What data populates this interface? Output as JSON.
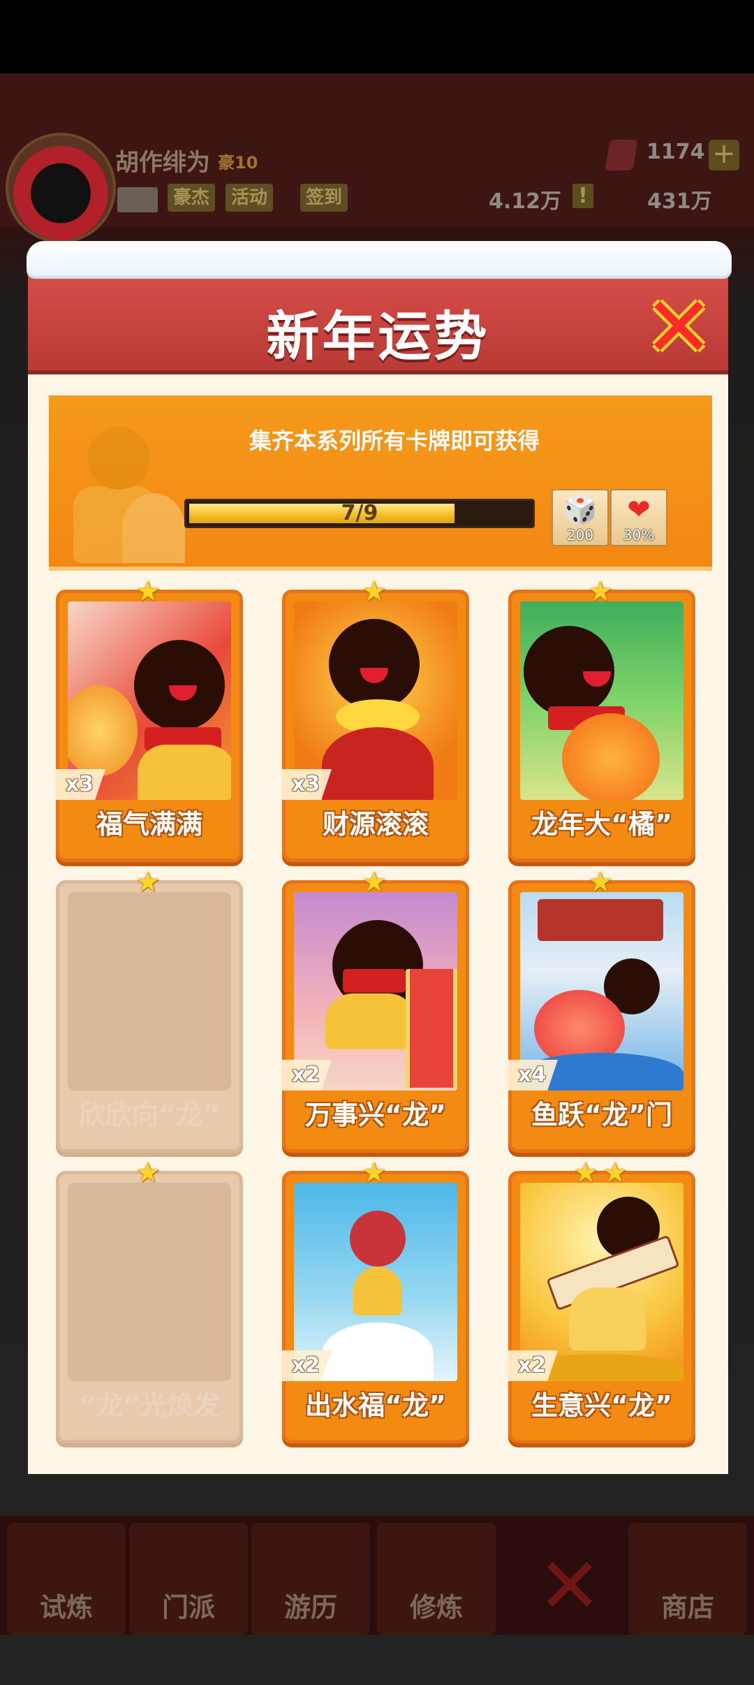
{
  "player": {
    "name": "胡作绯为",
    "level": "豪10",
    "buttons": [
      "豪杰",
      "活动",
      "签到"
    ],
    "gems": "1174",
    "power": "4.12万",
    "coins": "431万",
    "power_alert": "!",
    "add": "+"
  },
  "nav": {
    "items": [
      "试炼",
      "门派",
      "游历",
      "修炼",
      "商店"
    ],
    "close_icon": "✕"
  },
  "modal": {
    "title": "新年运势",
    "close_icon": "✕",
    "banner_text": "集齐本系列所有卡牌即可获得",
    "progress_label": "7/9",
    "progress_value": 0.7778,
    "rewards": [
      {
        "icon": "dice-icon",
        "value": "200"
      },
      {
        "icon": "heart-icon",
        "value": "30%"
      }
    ]
  },
  "cards": [
    {
      "name": "福气满满",
      "count": "x3",
      "stars": 1,
      "locked": false
    },
    {
      "name": "财源滚滚",
      "count": "x3",
      "stars": 1,
      "locked": false
    },
    {
      "name": "龙年大“橘”",
      "count": "",
      "stars": 1,
      "locked": false
    },
    {
      "name": "欣欣向“龙”",
      "count": "",
      "stars": 1,
      "locked": true
    },
    {
      "name": "万事兴“龙”",
      "count": "x2",
      "stars": 1,
      "locked": false
    },
    {
      "name": "鱼跃“龙”门",
      "count": "x4",
      "stars": 1,
      "locked": false
    },
    {
      "name": "“龙”光焕发",
      "count": "",
      "stars": 1,
      "locked": true
    },
    {
      "name": "出水福“龙”",
      "count": "x2",
      "stars": 1,
      "locked": false
    },
    {
      "name": "生意兴“龙”",
      "count": "x2",
      "stars": 2,
      "locked": false
    }
  ],
  "colors": {
    "header_red": "#d8504a",
    "banner_orange": "#f59a1b",
    "card_orange": "#f38b12",
    "star_yellow": "#ffd329"
  }
}
